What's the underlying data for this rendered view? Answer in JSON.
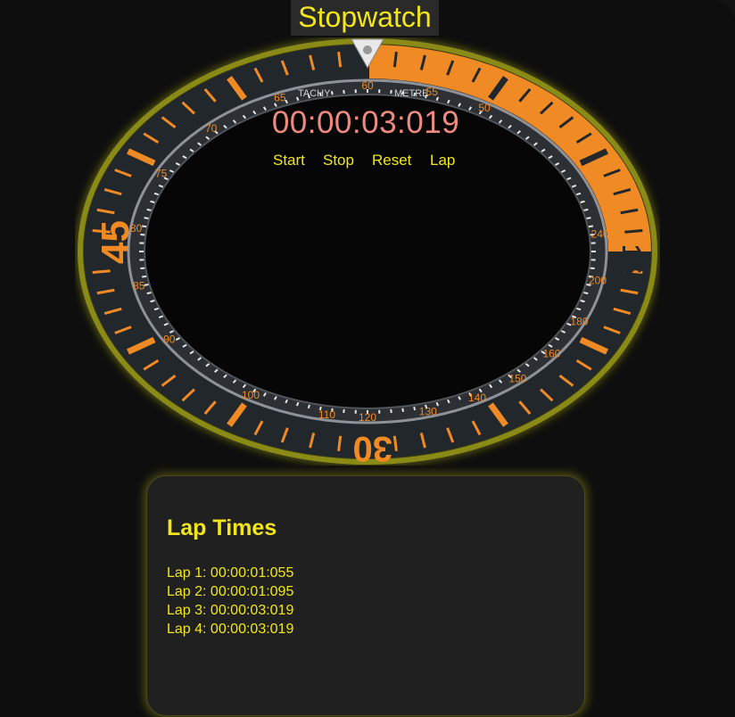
{
  "app": {
    "title": "Stopwatch"
  },
  "display": {
    "time": "00:00:03:019"
  },
  "controls": {
    "start_label": "Start",
    "stop_label": "Stop",
    "reset_label": "Reset",
    "lap_label": "Lap"
  },
  "bezel": {
    "scale_labels": [
      "45",
      "30",
      "15"
    ],
    "tachy_text": "TACHY",
    "metre_text": "METRE",
    "tachy_numbers": [
      "60",
      "65",
      "70",
      "75",
      "80",
      "85",
      "90",
      "100",
      "110",
      "120",
      "130",
      "140",
      "150",
      "160",
      "180",
      "200",
      "240",
      "50",
      "55"
    ]
  },
  "laps": {
    "heading": "Lap Times",
    "items": [
      "Lap 1: 00:00:01:055",
      "Lap 2: 00:00:01:095",
      "Lap 3: 00:00:03:019",
      "Lap 4: 00:00:03:019"
    ]
  },
  "colors": {
    "accent": "#f2e61b",
    "time": "#ee8a7e",
    "bezel_orange": "#f08a24",
    "background": "#0e0e0e"
  }
}
